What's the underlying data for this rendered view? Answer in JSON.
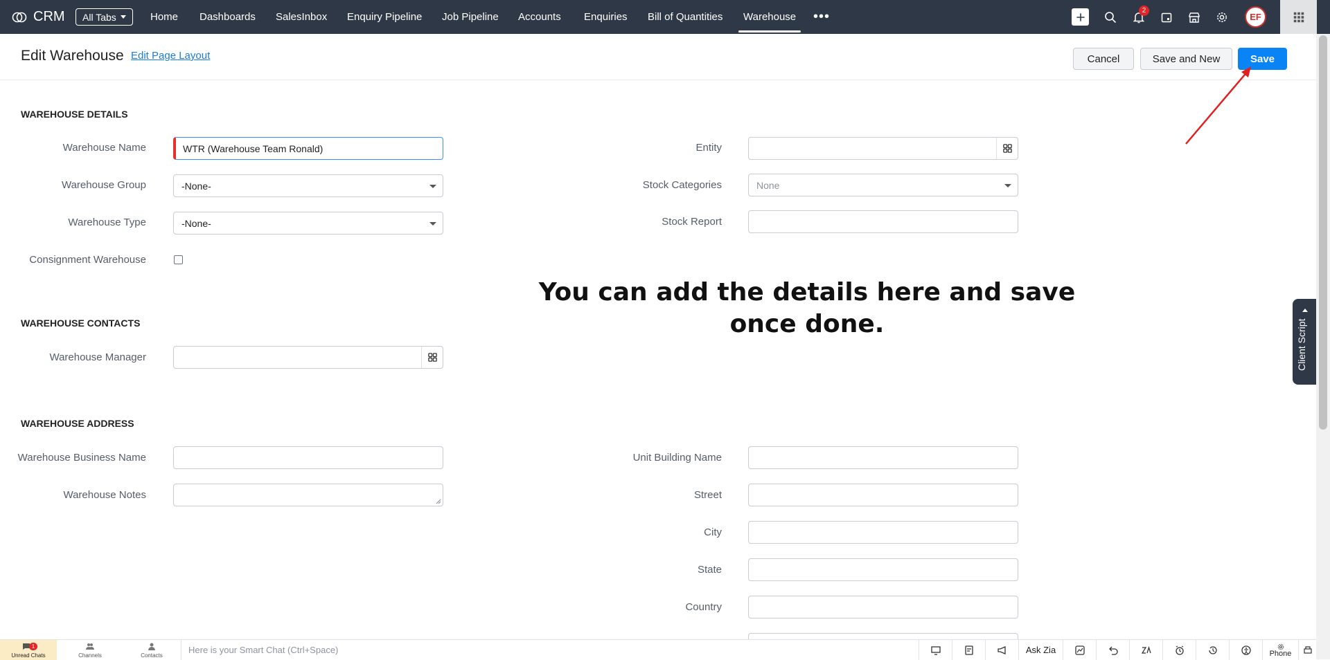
{
  "app": {
    "name": "CRM"
  },
  "nav": {
    "all_tabs": "All Tabs",
    "tabs": [
      "Home",
      "Dashboards",
      "SalesInbox",
      "Enquiry Pipeline",
      "Job Pipeline",
      "Accounts",
      "Enquiries",
      "Bill of Quantities",
      "Warehouse"
    ],
    "active_tab": "Warehouse",
    "more": "•••",
    "notification_count": "2"
  },
  "header": {
    "title": "Edit Warehouse",
    "edit_layout": "Edit Page Layout",
    "cancel": "Cancel",
    "save_and_new": "Save and New",
    "save": "Save"
  },
  "sections": {
    "details": "WAREHOUSE DETAILS",
    "contacts": "WAREHOUSE CONTACTS",
    "address": "WAREHOUSE ADDRESS"
  },
  "fields": {
    "warehouse_name": {
      "label": "Warehouse Name",
      "value": "WTR (Warehouse Team Ronald)"
    },
    "warehouse_group": {
      "label": "Warehouse Group",
      "value": "-None-"
    },
    "warehouse_type": {
      "label": "Warehouse Type",
      "value": "-None-"
    },
    "consignment": {
      "label": "Consignment Warehouse",
      "checked": false
    },
    "entity": {
      "label": "Entity",
      "value": ""
    },
    "stock_categories": {
      "label": "Stock Categories",
      "value": "None"
    },
    "stock_report": {
      "label": "Stock Report",
      "value": ""
    },
    "warehouse_manager": {
      "label": "Warehouse Manager",
      "value": ""
    },
    "business_name": {
      "label": "Warehouse Business Name",
      "value": ""
    },
    "notes": {
      "label": "Warehouse Notes",
      "value": ""
    },
    "unit_building": {
      "label": "Unit Building Name",
      "value": ""
    },
    "street": {
      "label": "Street",
      "value": ""
    },
    "city": {
      "label": "City",
      "value": ""
    },
    "state": {
      "label": "State",
      "value": ""
    },
    "country": {
      "label": "Country",
      "value": ""
    }
  },
  "overlay_message": "You can add the details here and save once done.",
  "client_script": "Client Script",
  "bottombar": {
    "unread_chats": "Unread Chats",
    "unread_count": "1",
    "channels": "Channels",
    "contacts": "Contacts",
    "smart_chat_placeholder": "Here is your Smart Chat (Ctrl+Space)",
    "ask_zia": "Ask Zia",
    "phone": "Phone"
  },
  "colors": {
    "nav_bg": "#2f3847",
    "primary": "#0a84f5",
    "link": "#1b7cd6",
    "badge": "#e42527",
    "annotation_arrow": "#e02020"
  }
}
